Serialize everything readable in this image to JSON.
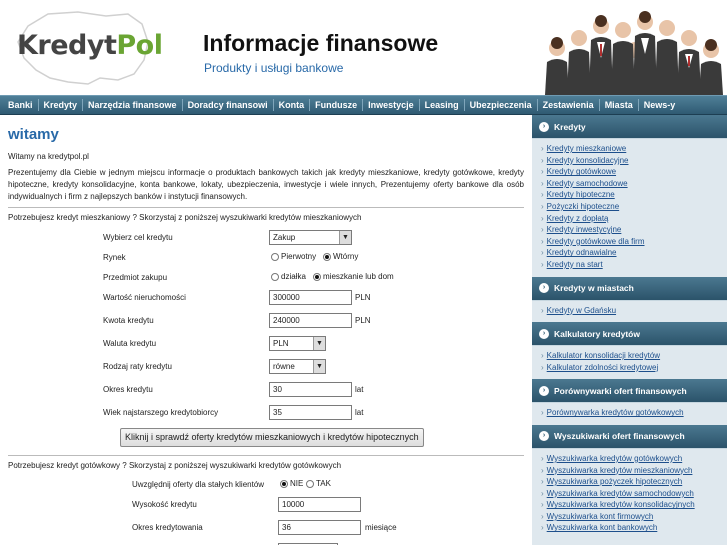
{
  "header": {
    "logo_k": "Kredyt",
    "logo_p": "Pol",
    "title": "Informacje finansowe",
    "subtitle": "Produkty i usługi bankowe"
  },
  "nav": [
    "Banki",
    "Kredyty",
    "Narzędzia finansowe",
    "Doradcy finansowi",
    "Konta",
    "Fundusze",
    "Inwestycje",
    "Leasing",
    "Ubezpieczenia",
    "Zestawienia",
    "Miasta",
    "News-y"
  ],
  "main": {
    "heading": "witamy",
    "welcome": "Witamy na kredytpol.pl",
    "intro": "Prezentujemy dla Ciebie w jednym miejscu informacje o produktach bankowych takich jak kredyty mieszkaniowe, kredyty gotówkowe, kredyty hipoteczne, kredyty konsolidacyjne, konta bankowe, lokaty, ubezpieczenia, inwestycje i wiele innych, Prezentujemy oferty bankowe dla osób indywidualnych i firm z najlepszych banków i instytucji finansowych.",
    "mortgage_lead": "Potrzebujesz kredyt mieszkaniowy ? Skorzystaj z poniższej wyszukiwarki kredytów mieszkaniowych",
    "mortgage_form": {
      "cel_label": "Wybierz cel kredytu",
      "cel_value": "Zakup",
      "rynek_label": "Rynek",
      "rynek_opt1": "Pierwotny",
      "rynek_opt2": "Wtórny",
      "przedmiot_label": "Przedmiot zakupu",
      "przedmiot_opt1": "działka",
      "przedmiot_opt2": "mieszkanie lub dom",
      "wartosc_label": "Wartość nieruchomości",
      "wartosc_value": "300000",
      "wartosc_unit": "PLN",
      "kwota_label": "Kwota kredytu",
      "kwota_value": "240000",
      "kwota_unit": "PLN",
      "waluta_label": "Waluta kredytu",
      "waluta_value": "PLN",
      "raty_label": "Rodzaj raty kredytu",
      "raty_value": "równe",
      "okres_label": "Okres kredytu",
      "okres_value": "30",
      "okres_unit": "lat",
      "wiek_label": "Wiek najstarszego kredytobiorcy",
      "wiek_value": "35",
      "wiek_unit": "lat",
      "submit": "Kliknij i sprawdź oferty kredytów mieszkaniowych i kredytów hipotecznych"
    },
    "cash_lead": "Potrzebujesz kredyt gotówkowy ? Skorzystaj z poniższej wyszukiwarki kredytów gotówkowych",
    "cash_form": {
      "oferty_label": "Uwzględnij oferty dla stałych klientów",
      "oferty_opt1": "NIE",
      "oferty_opt2": "TAK",
      "wysokosc_label": "Wysokość kredytu",
      "wysokosc_value": "10000",
      "okres_label": "Okres kredytowania",
      "okres_value": "36",
      "okres_unit": "miesiące"
    }
  },
  "sidebar": [
    {
      "title": "Kredyty",
      "items": [
        "Kredyty mieszkaniowe",
        "Kredyty konsolidacyjne",
        "Kredyty gotówkowe",
        "Kredyty samochodowe",
        "Kredyty hipoteczne",
        "Pożyczki hipoteczne",
        "Kredyty z dopłatą",
        "Kredyty inwestycyjne",
        "Kredyty gotówkowe dla firm",
        "Kredyty odnawialne",
        "Kredyty na start"
      ]
    },
    {
      "title": "Kredyty w miastach",
      "items": [
        "Kredyty w Gdańsku"
      ]
    },
    {
      "title": "Kalkulatory kredytów",
      "items": [
        "Kalkulator konsolidacji kredytów",
        "Kalkulator zdolności kredytowej"
      ]
    },
    {
      "title": "Porównywarki ofert finansowych",
      "items": [
        "Porównywarka kredytów gotówkowych"
      ]
    },
    {
      "title": "Wyszukiwarki ofert finansowych",
      "items": [
        "Wyszukiwarka kredytów gotówkowych",
        "Wyszukiwarka kredytów mieszkaniowych",
        "Wyszukiwarka pożyczek hipotecznych",
        "Wyszukiwarka kredytów samochodowych",
        "Wyszukiwarka kredytów konsolidacyjnych",
        "Wyszukiwarka kont firmowych",
        "Wyszukiwarka kont bankowych"
      ]
    }
  ]
}
